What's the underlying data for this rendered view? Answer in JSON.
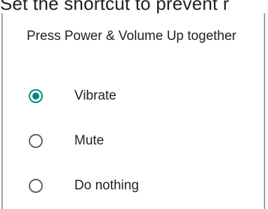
{
  "background_text": "Set the shortcut to prevent r",
  "dialog": {
    "title": "Press Power & Volume Up together",
    "options": [
      {
        "label": "Vibrate",
        "selected": true
      },
      {
        "label": "Mute",
        "selected": false
      },
      {
        "label": "Do nothing",
        "selected": false
      }
    ]
  },
  "colors": {
    "accent": "#00897b",
    "radio_unchecked": "#5f6368",
    "text": "#212121"
  }
}
